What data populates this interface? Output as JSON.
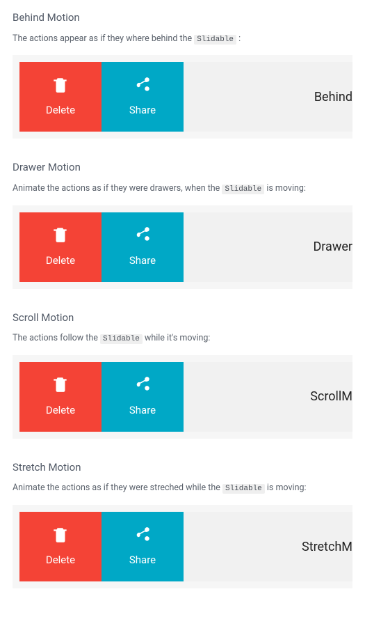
{
  "code_token": "Slidable",
  "actions": {
    "delete_label": "Delete",
    "share_label": "Share"
  },
  "sections": [
    {
      "heading": "Behind Motion",
      "desc_before": "The actions appear as if they where behind the ",
      "desc_after": " :",
      "content_label": "Behind"
    },
    {
      "heading": "Drawer Motion",
      "desc_before": "Animate the actions as if they were drawers, when the ",
      "desc_after": "  is moving:",
      "content_label": "Drawer"
    },
    {
      "heading": "Scroll Motion",
      "desc_before": "The actions follow the ",
      "desc_after": "  while it's moving:",
      "content_label": "ScrollM"
    },
    {
      "heading": "Stretch Motion",
      "desc_before": "Animate the actions as if they were streched while the ",
      "desc_after": "  is moving:",
      "content_label": "StretchM"
    }
  ]
}
